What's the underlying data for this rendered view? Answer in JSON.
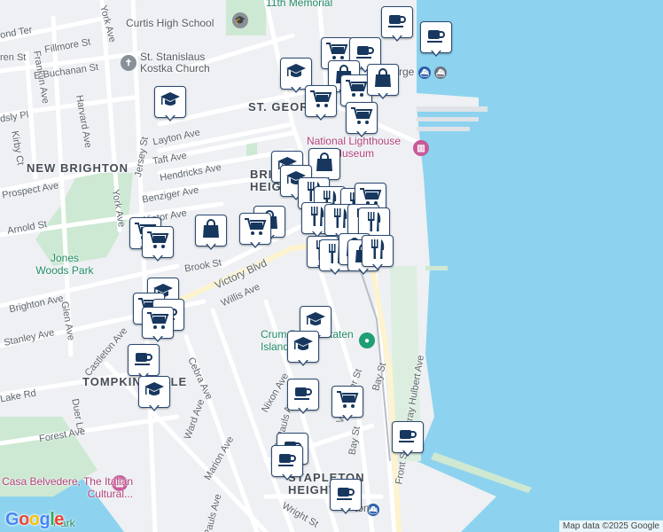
{
  "map": {
    "neighborhoods": [
      {
        "name": "NEW BRIGHTON"
      },
      {
        "name": "ST. GEORGE"
      },
      {
        "name": "BRIGHTON HEIGHTS"
      },
      {
        "name": "TOMPKINSVILLE"
      },
      {
        "name": "STAPLETON HEIGHTS"
      }
    ],
    "streets": [
      "ond Ter",
      "York Ave",
      "Fillmore St",
      "ren St",
      "Franklin Ave",
      "E Buchanan St",
      "Harvard Ave",
      "dsly Pl",
      "Kirby Ct",
      "Layton Ave",
      "Taft Ave",
      "Hendricks Ave",
      "Jersey St",
      "Prospect Ave",
      "Benziger Ave",
      "Wintor Ave",
      "Arnold St",
      "York Ave",
      "Brook St",
      "Victory Blvd",
      "Willis Ave",
      "Brighton Ave",
      "Glen Ave",
      "Stanley Ave",
      "Castleton Ave",
      "Cebra Ave",
      "Lake Rd",
      "Duer Ln",
      "Forest Ave",
      "Ward Ave",
      "Marion Ave",
      "Nixon Ave",
      "St Pauls Ave",
      "Van Duzer St",
      "Bay St",
      "Murray Hulbert Ave",
      "Front St",
      "Wright St",
      "Pauls Ave",
      "Bay St"
    ],
    "pois": [
      {
        "name": "Curtis High School",
        "kind": "school"
      },
      {
        "name": "11th Memorial",
        "kind": "memorial"
      },
      {
        "name": "St. Stanislaus Kostka Church",
        "kind": "church"
      },
      {
        "name": "National Lighthouse Museum",
        "kind": "museum"
      },
      {
        "name": "Jones Woods Park",
        "kind": "park"
      },
      {
        "name": "Crum Pass - Staten Island",
        "kind": "transit"
      },
      {
        "name": "Casa Belvedere, The Italian Cultural...",
        "kind": "museum"
      },
      {
        "name": "Park",
        "kind": "park"
      }
    ],
    "partial_labels": [
      "rge",
      "ton"
    ],
    "markers": {
      "legend": {
        "cafe": "coffee-cup-icon",
        "grocery": "shopping-cart-icon",
        "school": "graduation-cap-icon",
        "shop": "shopping-bag-icon",
        "restaurant": "fork-knife-icon"
      },
      "colors": {
        "marker_border": "#2b4a73",
        "icon": "#17375e",
        "water": "#8dd3ef",
        "park": "#cde9d3",
        "road": "#ffffff"
      }
    }
  },
  "footer": {
    "logo": "Google",
    "attribution": "Map data ©2025 Google"
  }
}
